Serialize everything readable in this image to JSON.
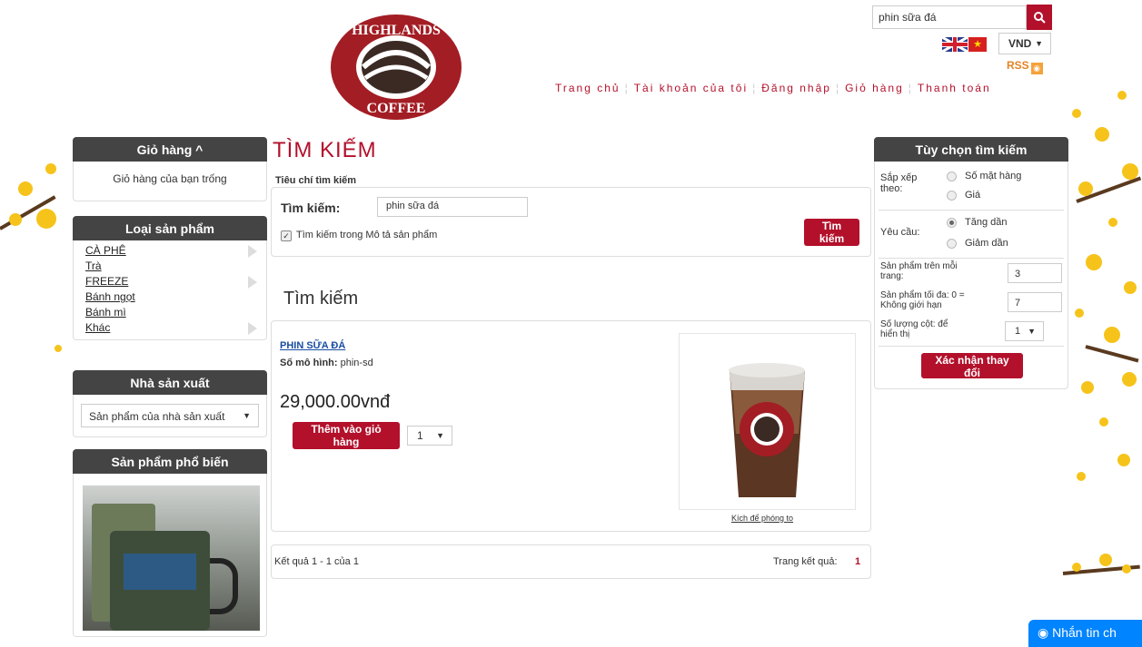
{
  "header": {
    "search_value": "phin sữa đá",
    "currency": "VND",
    "rss_label": "RSS",
    "nav": [
      "Trang chủ",
      "Tài khoản của tôi",
      "Đăng nhập",
      "Giỏ hàng",
      "Thanh toán"
    ],
    "logo_top": "HIGHLANDS",
    "logo_bottom": "COFFEE"
  },
  "left": {
    "cart_title": "Giỏ hàng ^",
    "cart_empty": "Giỏ hàng của bạn trống",
    "categories_title": "Loại sản phẩm",
    "categories": [
      {
        "label": "CÀ PHÊ",
        "has_arrow": true
      },
      {
        "label": "Trà",
        "has_arrow": false
      },
      {
        "label": "FREEZE",
        "has_arrow": true
      },
      {
        "label": "Bánh ngọt",
        "has_arrow": false
      },
      {
        "label": "Bánh mì",
        "has_arrow": false
      },
      {
        "label": "Khác",
        "has_arrow": true
      }
    ],
    "manufacturer_title": "Nhà sản xuất",
    "manufacturer_select": "Sản phẩm của nhà sản xuất",
    "popular_title": "Sản phẩm phổ biến"
  },
  "main": {
    "title": "TÌM KIẾM",
    "criteria_label": "Tiêu chí tìm kiếm",
    "search_label": "Tìm kiếm:",
    "search_value": "phin sữa đá",
    "search_desc_checkbox": "Tìm kiếm trong Mô tả sản phẩm",
    "search_button": "Tìm kiếm",
    "results_heading": "Tìm kiếm",
    "product": {
      "name": "PHIN SỮA ĐÁ",
      "model_label": "Số mô hình:",
      "model_value": "phin-sd",
      "price": "29,000.00vnđ",
      "add_to_cart": "Thêm vào giỏ hàng",
      "qty": "1",
      "zoom_label": "Kích để phóng to"
    },
    "results_count": "Kết quả 1 - 1 của 1",
    "pages_label": "Trang kết quả:",
    "page_current": "1"
  },
  "right": {
    "title": "Tùy chọn tìm kiếm",
    "sort_label": "Sắp xếp theo:",
    "sort_options": [
      "Số mặt hàng",
      "Giá"
    ],
    "order_label": "Yêu cầu:",
    "order_options": [
      "Tăng dần",
      "Giảm dần"
    ],
    "per_page_label": "Sản phẩm trên mỗi trang:",
    "per_page_value": "3",
    "max_label": "Sản phẩm tối đa: 0 = Không giới hạn",
    "max_value": "7",
    "columns_label": "Số lượng cột: để hiển thị",
    "columns_value": "1",
    "confirm_button": "Xác nhận thay đổi"
  },
  "messenger": {
    "label": "Nhắn tin ch"
  },
  "colors": {
    "brand": "#b3102b",
    "header_bar": "#444444",
    "messenger": "#0084ff"
  }
}
